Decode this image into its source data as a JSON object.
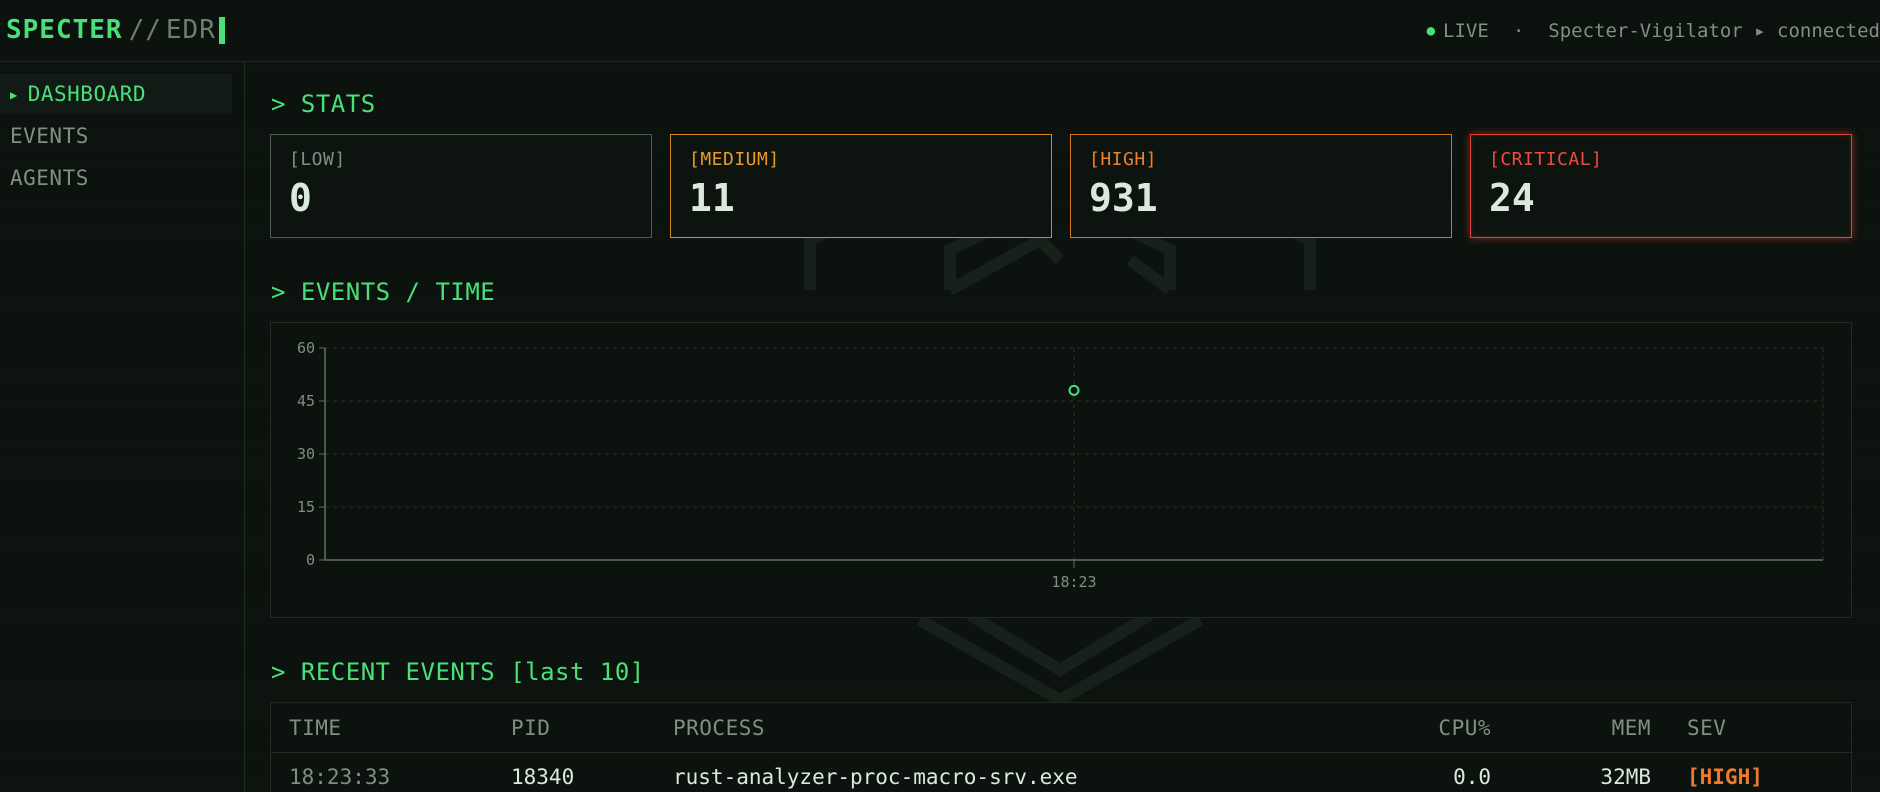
{
  "header": {
    "brand_primary": "SPECTER",
    "brand_separator": "//",
    "brand_secondary": "EDR",
    "live_label": "LIVE",
    "separator": "·",
    "agent_status": "Specter-Vigilator ▸ connected"
  },
  "sidebar": {
    "items": [
      {
        "label": "DASHBOARD",
        "active": true
      },
      {
        "label": "EVENTS",
        "active": false
      },
      {
        "label": "AGENTS",
        "active": false
      }
    ]
  },
  "sections": {
    "stats": "> STATS",
    "events_time": "> EVENTS / TIME",
    "recent": "> RECENT EVENTS [last 10]"
  },
  "stats": {
    "low": {
      "label": "[LOW]",
      "value": "0"
    },
    "medium": {
      "label": "[MEDIUM]",
      "value": "11"
    },
    "high": {
      "label": "[HIGH]",
      "value": "931"
    },
    "critical": {
      "label": "[CRITICAL]",
      "value": "24"
    }
  },
  "colors": {
    "accent": "#49e07a",
    "medium": "#e89a2a",
    "high": "#e9822a",
    "critical": "#ef4a40"
  },
  "chart_data": {
    "type": "scatter",
    "title": "",
    "xlabel": "",
    "ylabel": "",
    "x": [
      "18:23"
    ],
    "values": [
      48
    ],
    "yticks": [
      0,
      15,
      30,
      45,
      60
    ],
    "ylim": [
      0,
      60
    ],
    "grid": true
  },
  "table": {
    "columns": [
      "TIME",
      "PID",
      "PROCESS",
      "CPU%",
      "MEM",
      "SEV"
    ],
    "rows": [
      {
        "time": "18:23:33",
        "pid": "18340",
        "process": "rust-analyzer-proc-macro-srv.exe",
        "cpu": "0.0",
        "mem": "32MB",
        "sev": "[HIGH]"
      }
    ]
  }
}
